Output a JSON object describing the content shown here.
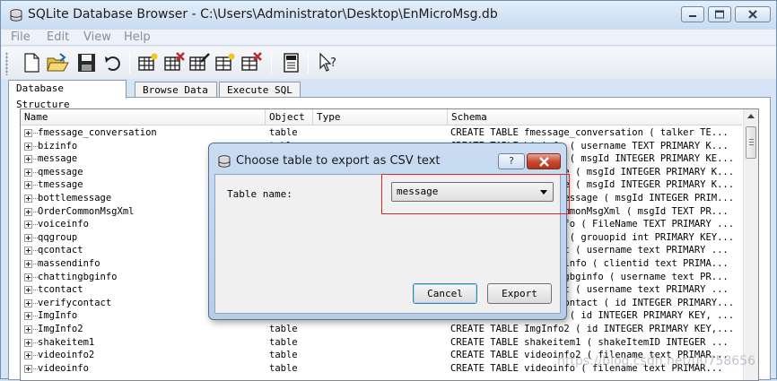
{
  "window": {
    "title": "SQLite Database Browser - C:\\Users\\Administrator\\Desktop\\EnMicroMsg.db"
  },
  "menu": [
    "File",
    "Edit",
    "View",
    "Help"
  ],
  "toolbar": {
    "buttons": [
      "new-database",
      "open-database",
      "save-database",
      "revert-changes",
      "create-table",
      "delete-table",
      "modify-table",
      "create-index",
      "delete-index",
      "query-log",
      "whats-this-help"
    ]
  },
  "tabs": [
    "Database Structure",
    "Browse Data",
    "Execute SQL"
  ],
  "grid": {
    "columns": [
      "Name",
      "Object",
      "Type",
      "Schema"
    ],
    "rows": [
      {
        "name": "fmessage_conversation",
        "object": "table",
        "schema": "CREATE TABLE fmessage_conversation (  talker TE..."
      },
      {
        "name": "bizinfo",
        "object": "table",
        "schema": "CREATE TABLE bizinfo (  username TEXT PRIMARY K..."
      },
      {
        "name": "message",
        "object": "table",
        "schema": "CREATE TABLE message (  msgId INTEGER PRIMARY KE..."
      },
      {
        "name": "qmessage",
        "object": "table",
        "schema": "CREATE TABLE qmessage (  msgId INTEGER PRIMARY K..."
      },
      {
        "name": "tmessage",
        "object": "table",
        "schema": "CREATE TABLE tmessage (  msgId INTEGER PRIMARY K..."
      },
      {
        "name": "bottlemessage",
        "object": "table",
        "schema": "CREATE TABLE bottlemessage (  msgId INTEGER PRIM..."
      },
      {
        "name": "OrderCommonMsgXml",
        "object": "table",
        "schema": "CREATE TABLE OrderCommonMsgXml (  msgId TEXT PR..."
      },
      {
        "name": "voiceinfo",
        "object": "table",
        "schema": "CREATE TABLE voiceinfo ( FileName TEXT PRIMARY ..."
      },
      {
        "name": "qqgroup",
        "object": "table",
        "schema": "CREATE TABLE qqgroup ( grouopid int PRIMARY KEY..."
      },
      {
        "name": "qcontact",
        "object": "table",
        "schema": "CREATE TABLE qcontact (  username text  PRIMARY ..."
      },
      {
        "name": "massendinfo",
        "object": "table",
        "schema": "CREATE TABLE massendinfo (  clientid text  PRIMA..."
      },
      {
        "name": "chattingbginfo",
        "object": "table",
        "schema": "CREATE TABLE chattingbginfo (  username text  PR..."
      },
      {
        "name": "tcontact",
        "object": "table",
        "schema": "CREATE TABLE tcontact (  username text  PRIMARY ..."
      },
      {
        "name": "verifycontact",
        "object": "table",
        "schema": "CREATE TABLE verifycontact (  id INTEGER PRIMARY..."
      },
      {
        "name": "ImgInfo",
        "object": "table",
        "schema": "CREATE TABLE ImgInfo ( id INTEGER PRIMARY KEY, ..."
      },
      {
        "name": "ImgInfo2",
        "object": "table",
        "schema": "CREATE TABLE ImgInfo2 ( id INTEGER PRIMARY KEY,..."
      },
      {
        "name": "shakeitem1",
        "object": "table",
        "schema": "CREATE TABLE shakeitem1 (  shakeItemID INTEGER ..."
      },
      {
        "name": "videoinfo2",
        "object": "table",
        "schema": "CREATE TABLE videoinfo2 ( filename text  PRIMAR..."
      },
      {
        "name": "videoinfo",
        "object": "table",
        "schema": "CREATE TABLE videoinfo ( filename text  PRIMAR..."
      }
    ]
  },
  "dialog": {
    "title": "Choose table to export as CSV text",
    "help_label": "?",
    "table_label": "Table name:",
    "selected_table": "message",
    "cancel_label": "Cancel",
    "export_label": "Export"
  },
  "watermark": "https://blog.csdn.net/u0758656",
  "colors": {
    "highlight_box": "#e02424",
    "title_gradient_top": "#e3eefa",
    "close_button": "#c6452d"
  }
}
